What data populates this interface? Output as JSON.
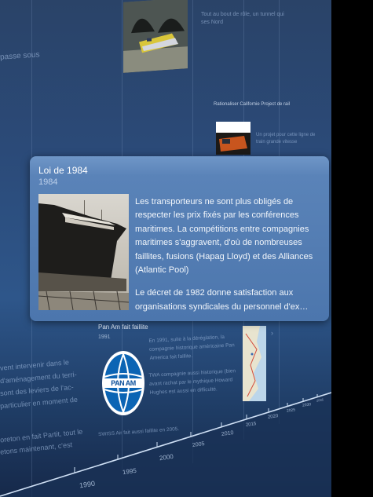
{
  "card": {
    "title": "Loi de 1984",
    "year": "1984",
    "paragraph1": "Les transporteurs ne sont plus obligés de respecter les prix fixés par les conférences maritimes. La compétitions entre compagnies maritimes s'aggravent, d'où de nombreuses faillites, fusions (Hapag Lloyd) et des Alliances (Atlantic Pool)",
    "paragraph2": "Le décret de 1982 donne satisfaction aux organisations syndicales du personnel d'ex…"
  },
  "background": {
    "top_left_text": "passe sous",
    "top_thumb_text": "Tout au bout de rôle, un tunnel qui ses Nord",
    "rail_title": "Rationaliser Californie Project de rail",
    "rail_text": "Un projet pour cette ligne de train grande vitesse",
    "panam_title": "Pan Am fait faillite",
    "panam_year": "1991",
    "panam_text1": "En 1991, suite à la déréglation, la compagnie historique américaine Pan America fait faillite.",
    "panam_text2": "TWA compagnie aussi historique (bien avant rachat par le mythique Howard Hughes est aussi en difficulté.",
    "swiss_text": "SWISS Air fait aussi faillite en 2005.",
    "panam_logo_text": "PAN AM",
    "left_text1": "vent intervenir dans le",
    "left_text2": "d'aménagement du terri-",
    "left_text3": "sont des leviers de l'ac-",
    "left_text4": "particulier en moment de",
    "left_text5": "oreton en fait Partit, tout le",
    "left_text6": "etons maintenant, c'est"
  },
  "axis": {
    "years": [
      "1990",
      "1995",
      "2000",
      "2005",
      "2010",
      "2015",
      "2020",
      "2025",
      "2030",
      "2035"
    ]
  }
}
